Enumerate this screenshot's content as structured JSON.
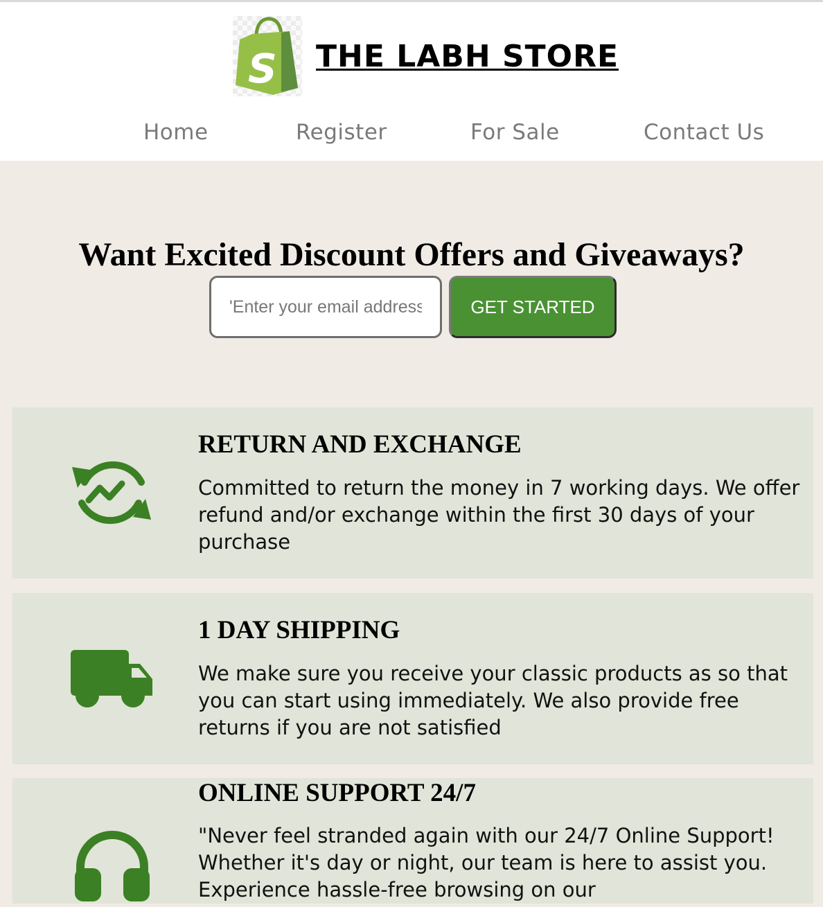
{
  "header": {
    "brand_name": "THE LABH STORE",
    "logo_icon": "shopping-bag-logo-icon",
    "logo_color": "#96bf48"
  },
  "nav": {
    "items": [
      {
        "label": "Home"
      },
      {
        "label": "Register"
      },
      {
        "label": "For Sale"
      },
      {
        "label": "Contact Us"
      }
    ]
  },
  "promo": {
    "title": "Want Excited Discount Offers and Giveaways?",
    "email_placeholder": "'Enter your email address'",
    "button_label": "GET STARTED",
    "button_color": "#4a9134"
  },
  "features": [
    {
      "icon": "refresh-trend-icon",
      "title": "RETURN AND EXCHANGE",
      "text": "Committed to return the money in 7 working days. We offer refund and/or exchange within the first 30 days of your purchase"
    },
    {
      "icon": "truck-icon",
      "title": "1 DAY SHIPPING",
      "text": "We make sure you receive your classic products as so that you can start using immediately. We also provide free returns if you are not satisfied"
    },
    {
      "icon": "headset-icon",
      "title": "ONLINE SUPPORT 24/7",
      "text": "\"Never feel stranded again with our 24/7 Online Support! Whether it's day or night, our team is here to assist you. Experience hassle-free browsing on our"
    }
  ],
  "colors": {
    "icon_green": "#3b8024",
    "feature_bg": "#e1e4d8",
    "page_bg": "#f0ebe5"
  }
}
